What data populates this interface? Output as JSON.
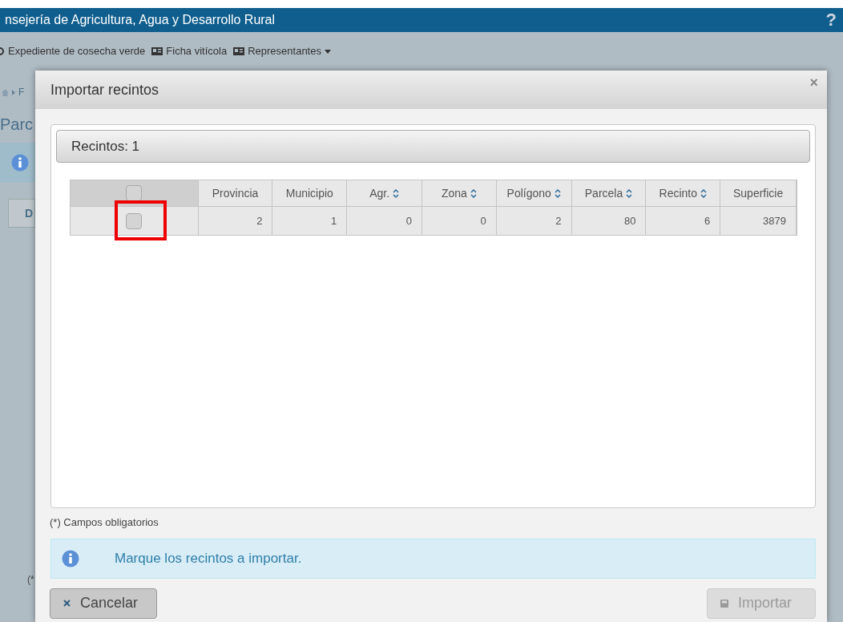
{
  "header": {
    "title": "nsejería de Agricultura, Agua y Desarrollo Rural",
    "help": "?"
  },
  "toolbar": [
    {
      "label": "Expediente de cosecha verde",
      "kind": "partial"
    },
    {
      "label": "Ficha vitícola",
      "kind": "card"
    },
    {
      "label": "Representantes",
      "kind": "dropdown"
    }
  ],
  "background": {
    "breadcrumb": "F",
    "page_title": "Parc",
    "tab": "D",
    "footnote": "(*"
  },
  "dialog": {
    "title": "Importar recintos",
    "close": "×",
    "panel_title": "Recintos: 1",
    "table": {
      "select_all": {
        "checked": false
      },
      "columns": [
        {
          "label": "Provincia",
          "sortable": false
        },
        {
          "label": "Municipio",
          "sortable": false
        },
        {
          "label": "Agr.",
          "sortable": true
        },
        {
          "label": "Zona",
          "sortable": true
        },
        {
          "label": "Polígono",
          "sortable": true
        },
        {
          "label": "Parcela",
          "sortable": true
        },
        {
          "label": "Recinto",
          "sortable": true
        },
        {
          "label": "Superficie",
          "sortable": false
        }
      ],
      "rows": [
        {
          "checked": false,
          "highlighted": true,
          "cells": [
            "2",
            "1",
            "0",
            "0",
            "2",
            "80",
            "6",
            "3879"
          ]
        }
      ]
    },
    "required_note": "(*) Campos obligatorios",
    "info_message": "Marque los recintos a importar.",
    "buttons": [
      {
        "label": "Cancelar",
        "kind": "cancel",
        "disabled": false
      },
      {
        "label": "Importar",
        "kind": "submit",
        "disabled": true
      }
    ]
  }
}
